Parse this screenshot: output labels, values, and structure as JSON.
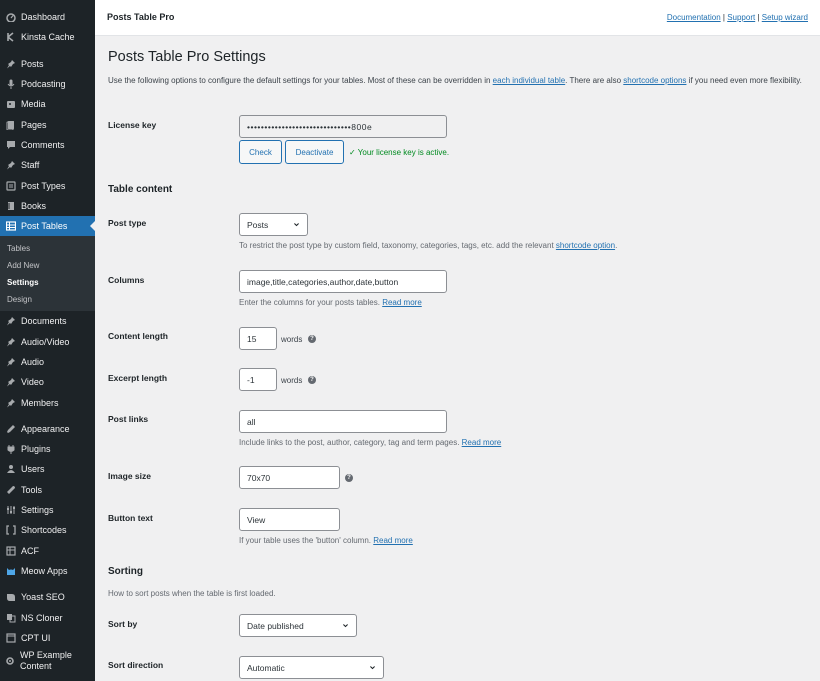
{
  "sidebar": {
    "group1": [
      {
        "label": "Dashboard",
        "icon": "dashboard-icon"
      },
      {
        "label": "Kinsta Cache",
        "icon": "kinsta-icon"
      }
    ],
    "group2": [
      {
        "label": "Posts",
        "icon": "pin-icon"
      },
      {
        "label": "Podcasting",
        "icon": "microphone-icon"
      },
      {
        "label": "Media",
        "icon": "media-icon"
      },
      {
        "label": "Pages",
        "icon": "pages-icon"
      },
      {
        "label": "Comments",
        "icon": "comment-icon"
      },
      {
        "label": "Staff",
        "icon": "pin-icon"
      },
      {
        "label": "Post Types",
        "icon": "post-types-icon"
      },
      {
        "label": "Books",
        "icon": "book-icon"
      }
    ],
    "active": {
      "label": "Post Tables",
      "icon": "table-icon"
    },
    "submenu": [
      "Tables",
      "Add New",
      "Settings",
      "Design"
    ],
    "submenu_current": 2,
    "group3": [
      {
        "label": "Documents",
        "icon": "pin-icon"
      },
      {
        "label": "Audio/Video",
        "icon": "pin-icon"
      },
      {
        "label": "Audio",
        "icon": "pin-icon"
      },
      {
        "label": "Video",
        "icon": "pin-icon"
      },
      {
        "label": "Members",
        "icon": "pin-icon"
      }
    ],
    "group4": [
      {
        "label": "Appearance",
        "icon": "appearance-icon"
      },
      {
        "label": "Plugins",
        "icon": "plugin-icon"
      },
      {
        "label": "Users",
        "icon": "users-icon"
      },
      {
        "label": "Tools",
        "icon": "tools-icon"
      },
      {
        "label": "Settings",
        "icon": "settings-icon"
      },
      {
        "label": "Shortcodes",
        "icon": "shortcode-icon"
      },
      {
        "label": "ACF",
        "icon": "acf-icon"
      },
      {
        "label": "Meow Apps",
        "icon": "meow-icon"
      }
    ],
    "group5": [
      {
        "label": "Yoast SEO",
        "icon": "yoast-icon"
      },
      {
        "label": "NS Cloner",
        "icon": "cloner-icon"
      },
      {
        "label": "CPT UI",
        "icon": "cptui-icon"
      },
      {
        "label": "WP Example Content",
        "icon": "gear-icon"
      }
    ]
  },
  "topbar": {
    "brand": "Posts Table Pro",
    "doc_link": "Documentation",
    "sep1": " | ",
    "support_link": "Support",
    "sep2": " | ",
    "wizard_link": "Setup wizard"
  },
  "page": {
    "title": "Posts Table Pro Settings",
    "intro_1": "Use the following options to configure the default settings for your tables. Most of these can be overridden in ",
    "intro_link1": "each individual table",
    "intro_2": ". There are also ",
    "intro_link2": "shortcode options",
    "intro_3": " if you need even more flexibility."
  },
  "license": {
    "label": "License key",
    "value": "••••••••••••••••••••••••••••••800e",
    "check": "Check",
    "deactivate": "Deactivate",
    "status": "✓ Your license key is active."
  },
  "table_content": {
    "heading": "Table content",
    "post_type_label": "Post type",
    "post_type_value": "Posts",
    "post_type_desc": "To restrict the post type by custom field, taxonomy, categories, tags, etc. add the relevant ",
    "post_type_link": "shortcode option",
    "post_type_desc_end": ".",
    "columns_label": "Columns",
    "columns_value": "image,title,categories,author,date,button",
    "columns_desc": "Enter the columns for your posts tables. ",
    "read_more": "Read more",
    "content_length_label": "Content length",
    "content_length_value": "15",
    "excerpt_length_label": "Excerpt length",
    "excerpt_length_value": "-1",
    "words": "words",
    "help": "?",
    "post_links_label": "Post links",
    "post_links_value": "all",
    "post_links_desc": "Include links to the post, author, category, tag and term pages. ",
    "image_size_label": "Image size",
    "image_size_value": "70x70",
    "button_text_label": "Button text",
    "button_text_value": "View",
    "button_text_desc": "If your table uses the 'button' column. "
  },
  "sorting": {
    "heading": "Sorting",
    "desc": "How to sort posts when the table is first loaded.",
    "sort_by_label": "Sort by",
    "sort_by_value": "Date published",
    "sort_dir_label": "Sort direction",
    "sort_dir_value": "Automatic"
  }
}
